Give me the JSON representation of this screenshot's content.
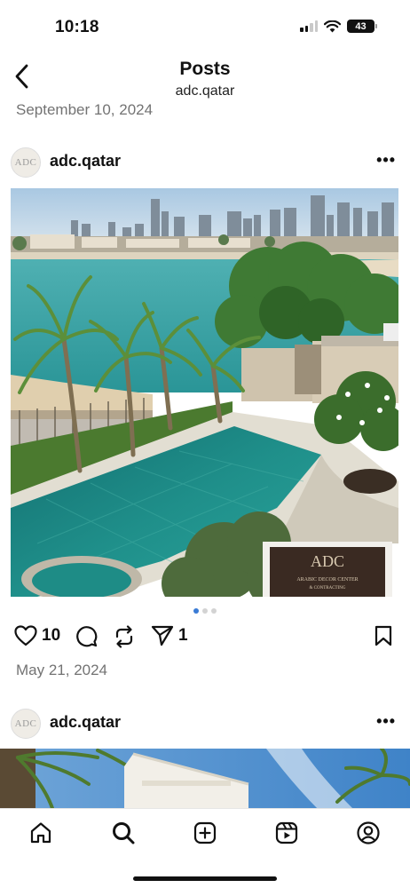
{
  "status_bar": {
    "time": "10:18",
    "battery": "43",
    "icons": [
      "cellular-signal-icon",
      "wifi-icon",
      "battery-icon"
    ]
  },
  "header": {
    "back_icon": "chevron-left-icon",
    "title": "Posts",
    "subtitle": "adc.qatar"
  },
  "prev_post_date": "September 10, 2024",
  "post": {
    "avatar_text": "ADC",
    "username": "adc.qatar",
    "more_label": "•••",
    "carousel": {
      "total": 3,
      "active_index": 0
    },
    "image_sign": {
      "logo": "ADC",
      "line1": "ARABIC DECOR CENTER",
      "line2": "& CONTRACTING"
    },
    "actions": {
      "like_count": "10",
      "share_count": "1",
      "icons": [
        "heart-icon",
        "comment-icon",
        "repost-icon",
        "send-icon",
        "bookmark-icon"
      ]
    },
    "date": "May 21, 2024"
  },
  "next_post": {
    "avatar_text": "ADC",
    "username": "adc.qatar",
    "more_label": "•••"
  },
  "bottom_nav": {
    "items": [
      "home-icon",
      "search-icon",
      "create-icon",
      "reels-icon",
      "profile-icon"
    ]
  },
  "colors": {
    "secondary_text": "#737373",
    "carousel_active": "#3a7bd5",
    "water": "#2c9a98",
    "pool": "#1e8c86"
  }
}
